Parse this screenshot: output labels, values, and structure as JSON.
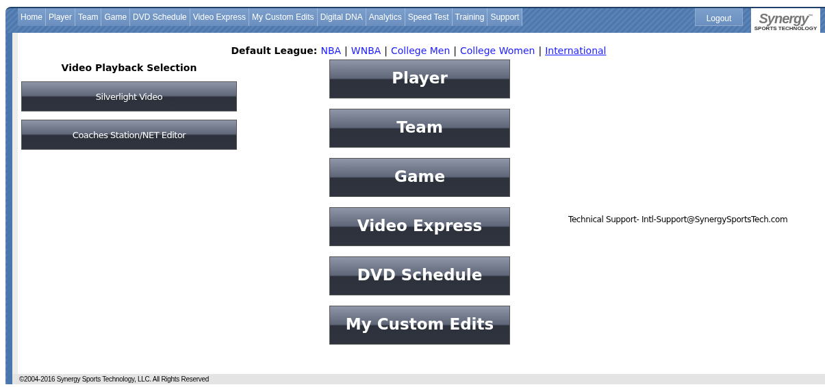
{
  "nav": {
    "items": [
      {
        "label": "Home"
      },
      {
        "label": "Player"
      },
      {
        "label": "Team"
      },
      {
        "label": "Game"
      },
      {
        "label": "DVD Schedule"
      },
      {
        "label": "Video Express"
      },
      {
        "label": "My Custom Edits"
      },
      {
        "label": "Digital DNA"
      },
      {
        "label": "Analytics"
      },
      {
        "label": "Speed Test"
      },
      {
        "label": "Training"
      },
      {
        "label": "Support"
      }
    ],
    "logout": "Logout",
    "logo": {
      "word": "Synergy",
      "mark": "™",
      "tagline": "SPORTS TECHNOLOGY"
    }
  },
  "league": {
    "label": "Default League:",
    "separator": "|",
    "options": [
      {
        "label": "NBA",
        "selected": false
      },
      {
        "label": "WNBA",
        "selected": false
      },
      {
        "label": "College Men",
        "selected": false
      },
      {
        "label": "College Women",
        "selected": false
      },
      {
        "label": "International",
        "selected": true
      }
    ]
  },
  "playback": {
    "title": "Video Playback Selection",
    "buttons": [
      "Silverlight Video",
      "Coaches Station/NET Editor"
    ]
  },
  "main_buttons": [
    "Player",
    "Team",
    "Game",
    "Video Express",
    "DVD Schedule",
    "My Custom Edits"
  ],
  "support_text": "Technical Support- Intl-Support@SynergySportsTech.com",
  "footer": "©2004-2016 Synergy Sports Technology, LLC. All Rights Reserved"
}
